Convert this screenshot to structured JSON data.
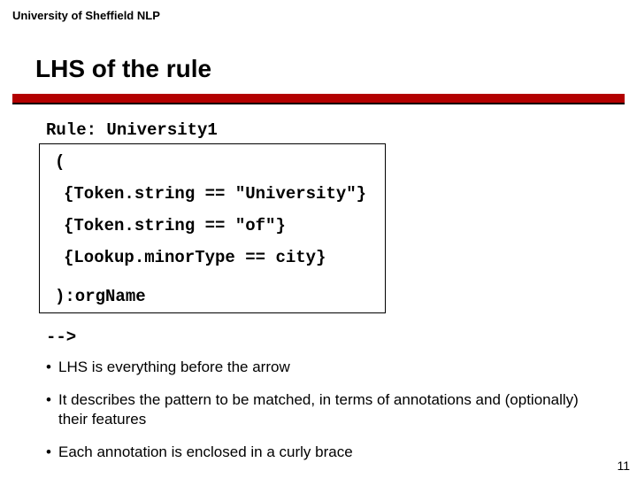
{
  "header": {
    "org": "University of Sheffield NLP"
  },
  "title": "LHS of the rule",
  "code": {
    "l1": "Rule: University1",
    "l2": "(",
    "l3": "{Token.string == \"University\"}",
    "l4": "{Token.string == \"of\"}",
    "l5": "{Lookup.minorType == city}",
    "l6": "):orgName",
    "l7": "-->"
  },
  "bullets": {
    "b1": "LHS is everything before the arrow",
    "b2": "It describes the pattern to be matched, in terms of annotations and (optionally) their features",
    "b3": "Each annotation is enclosed in a curly brace"
  },
  "page_number": "11"
}
